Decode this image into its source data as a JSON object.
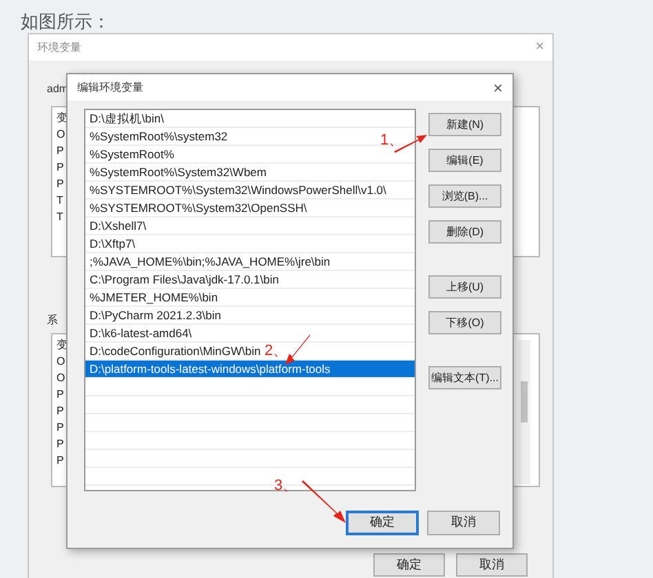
{
  "page_text": "如图所示：",
  "back_window": {
    "title": "环境变量",
    "close": "×",
    "user_label": "adm",
    "user_vars": [
      "变",
      "O",
      "P",
      "P",
      "P",
      "T",
      "T"
    ],
    "system_label": "系",
    "system_vars": [
      "变",
      "O",
      "O",
      "P",
      "P",
      "P",
      "P",
      "P"
    ],
    "buttons": [
      "确定",
      "取消"
    ]
  },
  "dialog": {
    "title": "编辑环境变量",
    "close": "×",
    "entries": [
      {
        "text": "D:\\虚拟机\\bin\\",
        "selected": false
      },
      {
        "text": "%SystemRoot%\\system32",
        "selected": false
      },
      {
        "text": "%SystemRoot%",
        "selected": false
      },
      {
        "text": "%SystemRoot%\\System32\\Wbem",
        "selected": false
      },
      {
        "text": "%SYSTEMROOT%\\System32\\WindowsPowerShell\\v1.0\\",
        "selected": false
      },
      {
        "text": "%SYSTEMROOT%\\System32\\OpenSSH\\",
        "selected": false
      },
      {
        "text": "D:\\Xshell7\\",
        "selected": false
      },
      {
        "text": "D:\\Xftp7\\",
        "selected": false
      },
      {
        "text": ";%JAVA_HOME%\\bin;%JAVA_HOME%\\jre\\bin",
        "selected": false
      },
      {
        "text": "C:\\Program Files\\Java\\jdk-17.0.1\\bin",
        "selected": false
      },
      {
        "text": "%JMETER_HOME%\\bin",
        "selected": false
      },
      {
        "text": "D:\\PyCharm 2021.2.3\\bin",
        "selected": false
      },
      {
        "text": "D:\\k6-latest-amd64\\",
        "selected": false
      },
      {
        "text": "D:\\codeConfiguration\\MinGW\\bin",
        "selected": false
      },
      {
        "text": "D:\\platform-tools-latest-windows\\platform-tools",
        "selected": true
      }
    ],
    "side_button_groups": [
      [
        "新建(N)",
        "编辑(E)",
        "浏览(B)...",
        "删除(D)"
      ],
      [
        "上移(U)",
        "下移(O)"
      ],
      [
        "编辑文本(T)..."
      ]
    ],
    "buttons": [
      {
        "label": "确定",
        "focused": true
      },
      {
        "label": "取消",
        "focused": false
      }
    ]
  },
  "annotations": [
    {
      "label": "1、"
    },
    {
      "label": "2、"
    },
    {
      "label": "3、"
    }
  ]
}
